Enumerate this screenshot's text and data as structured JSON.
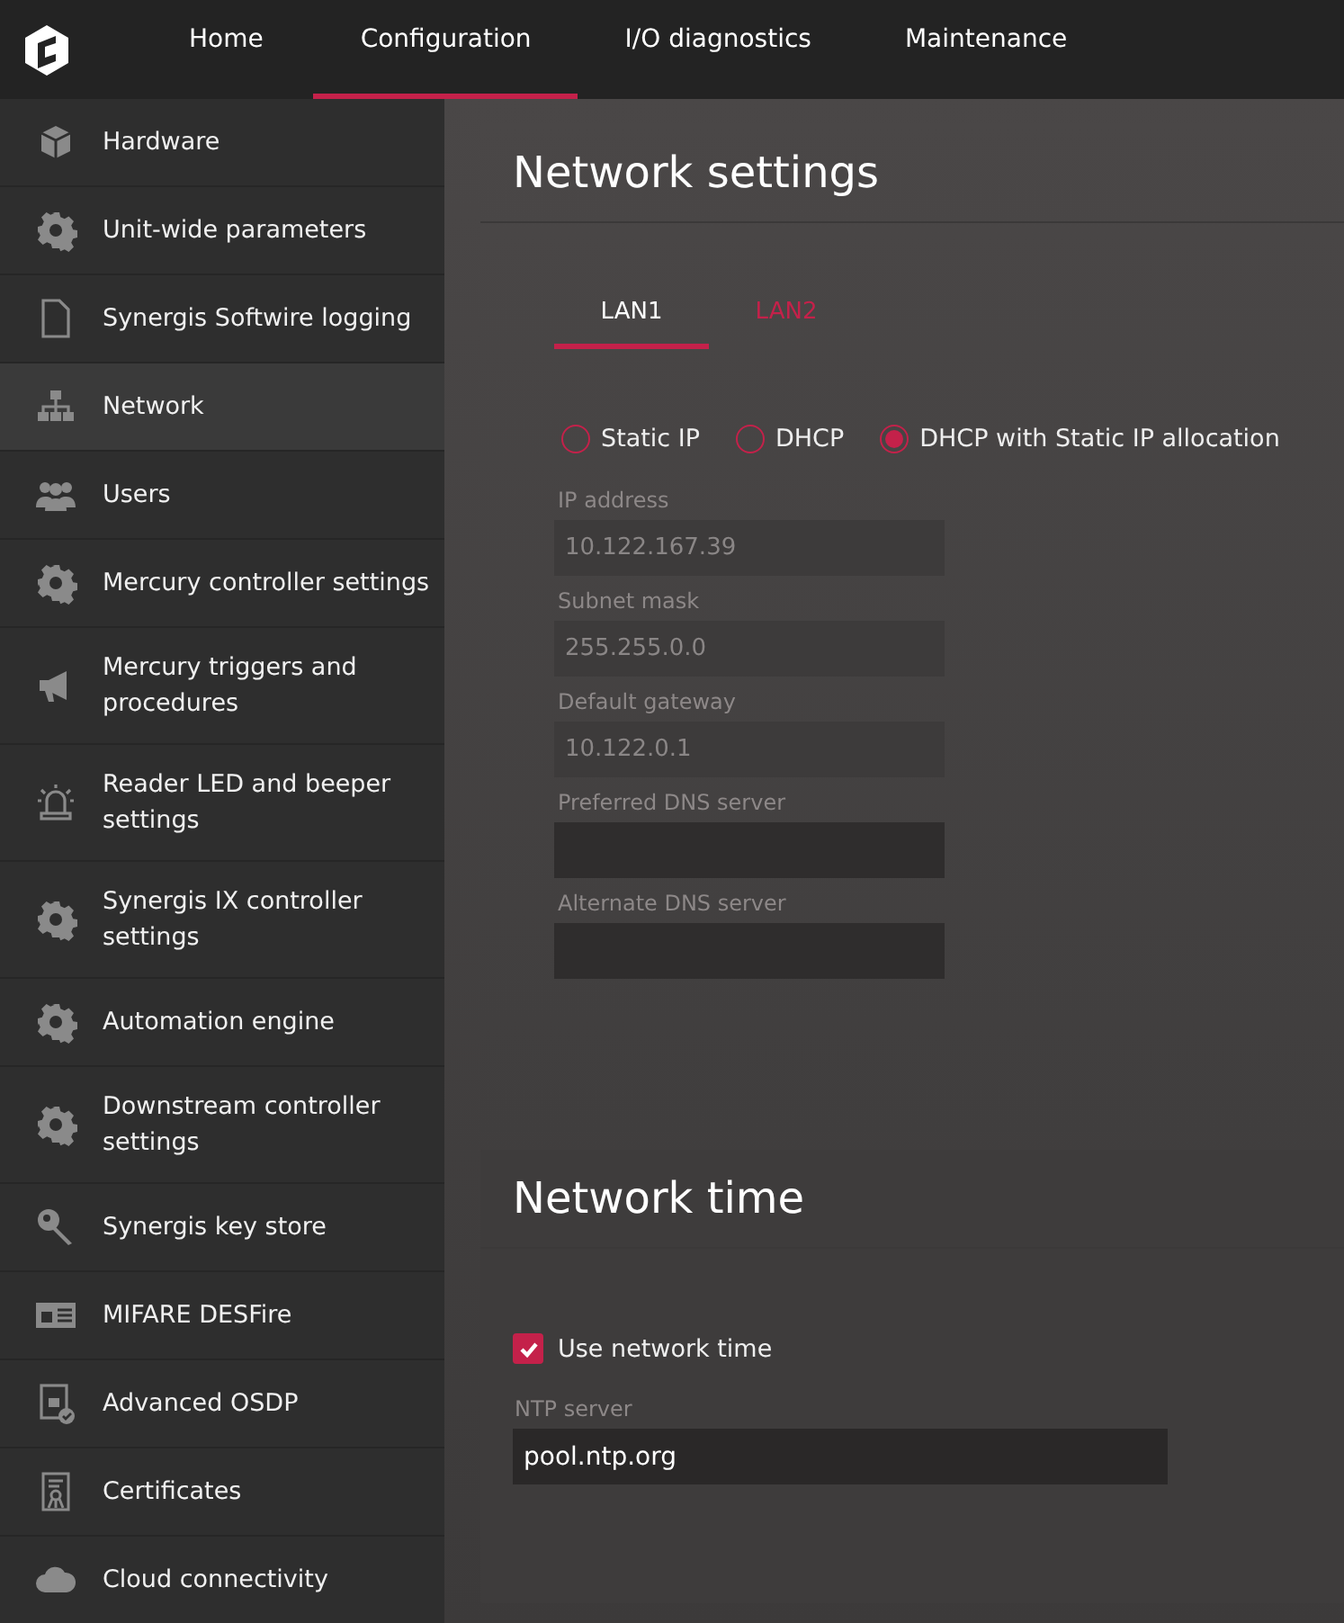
{
  "nav": {
    "tabs": [
      {
        "label": "Home",
        "selected": false
      },
      {
        "label": "Configuration",
        "selected": true
      },
      {
        "label": "I/O diagnostics",
        "selected": false
      },
      {
        "label": "Maintenance",
        "selected": false
      }
    ]
  },
  "sidebar": {
    "items": [
      {
        "label": "Hardware",
        "selected": false
      },
      {
        "label": "Unit-wide parameters",
        "selected": false
      },
      {
        "label": "Synergis Softwire logging",
        "selected": false
      },
      {
        "label": "Network",
        "selected": true
      },
      {
        "label": "Users",
        "selected": false
      },
      {
        "label": "Mercury controller settings",
        "selected": false
      },
      {
        "label": "Mercury triggers and procedures",
        "selected": false
      },
      {
        "label": "Reader LED and beeper settings",
        "selected": false
      },
      {
        "label": "Synergis IX controller settings",
        "selected": false
      },
      {
        "label": "Automation engine",
        "selected": false
      },
      {
        "label": "Downstream controller settings",
        "selected": false
      },
      {
        "label": "Synergis key store",
        "selected": false
      },
      {
        "label": "MIFARE DESFire",
        "selected": false
      },
      {
        "label": "Advanced OSDP",
        "selected": false
      },
      {
        "label": "Certificates",
        "selected": false
      },
      {
        "label": "Cloud connectivity",
        "selected": false
      }
    ]
  },
  "network_settings": {
    "title": "Network settings",
    "tabs": [
      {
        "label": "LAN1",
        "selected": true
      },
      {
        "label": "LAN2",
        "selected": false
      }
    ],
    "modes": [
      {
        "label": "Static IP",
        "selected": false
      },
      {
        "label": "DHCP",
        "selected": false
      },
      {
        "label": "DHCP with Static IP allocation",
        "selected": true
      }
    ],
    "fields": [
      {
        "label": "IP address",
        "value": "10.122.167.39",
        "disabled": true
      },
      {
        "label": "Subnet mask",
        "value": "255.255.0.0",
        "disabled": true
      },
      {
        "label": "Default gateway",
        "value": "10.122.0.1",
        "disabled": true
      },
      {
        "label": "Preferred DNS server",
        "disabled": false
      },
      {
        "label": "Alternate DNS server",
        "disabled": false
      }
    ]
  },
  "network_time": {
    "title": "Network time",
    "use_network_time": {
      "label": "Use network time",
      "checked": true
    },
    "ntp_server": {
      "label": "NTP server",
      "value": "pool.ntp.org"
    }
  }
}
